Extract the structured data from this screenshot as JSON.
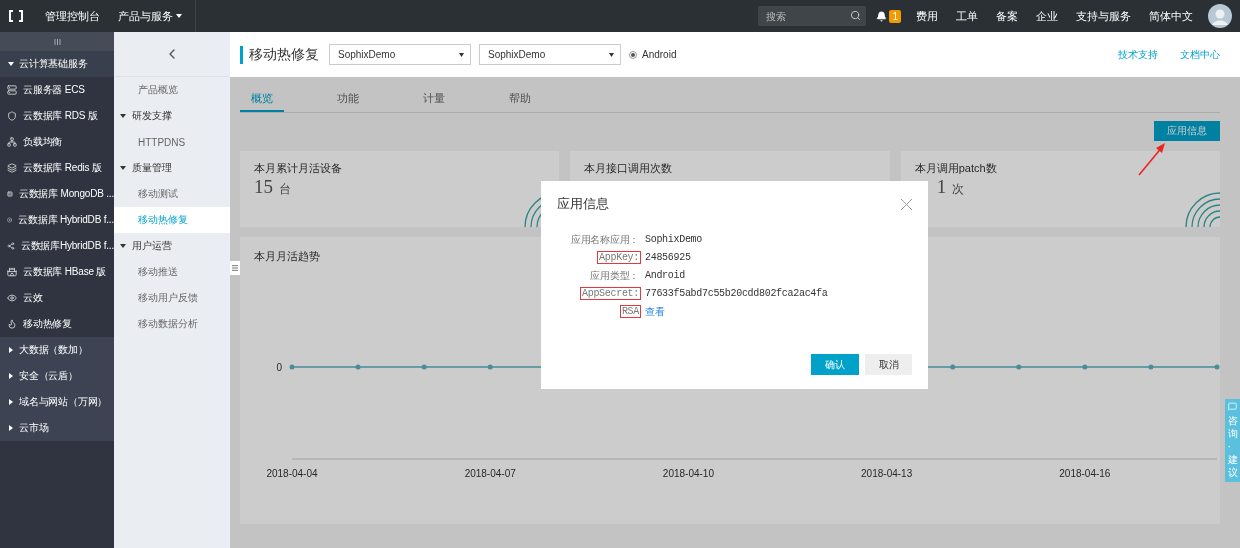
{
  "topbar": {
    "console": "管理控制台",
    "products": "产品与服务",
    "search": {
      "placeholder": "搜索"
    },
    "notification_count": "1",
    "links": [
      "费用",
      "工单",
      "备案",
      "企业",
      "支持与服务",
      "简体中文"
    ]
  },
  "sidebar": {
    "items": [
      {
        "kind": "group",
        "label": "云计算基础服务",
        "expanded": true
      },
      {
        "kind": "item",
        "label": "云服务器 ECS"
      },
      {
        "kind": "item",
        "label": "云数据库 RDS 版"
      },
      {
        "kind": "item",
        "label": "负载均衡"
      },
      {
        "kind": "item",
        "label": "云数据库 Redis 版"
      },
      {
        "kind": "item",
        "label": "云数据库 MongoDB ..."
      },
      {
        "kind": "item",
        "label": "云数据库 HybridDB f..."
      },
      {
        "kind": "item",
        "label": "云数据库HybridDB f..."
      },
      {
        "kind": "item",
        "label": "云数据库 HBase 版"
      },
      {
        "kind": "item",
        "label": "云效"
      },
      {
        "kind": "item",
        "label": "移动热修复"
      },
      {
        "kind": "group",
        "label": "大数据（数加）",
        "expanded": false
      },
      {
        "kind": "group",
        "label": "安全（云盾）",
        "expanded": false
      },
      {
        "kind": "group",
        "label": "域名与网站（万网）",
        "expanded": false
      },
      {
        "kind": "group",
        "label": "云市场",
        "expanded": false
      }
    ]
  },
  "subnav": {
    "items": [
      {
        "kind": "link",
        "label": "产品概览",
        "selected": false
      },
      {
        "kind": "group",
        "label": "研发支撑",
        "expanded": true
      },
      {
        "kind": "link",
        "label": "HTTPDNS",
        "selected": false
      },
      {
        "kind": "group",
        "label": "质量管理",
        "expanded": true
      },
      {
        "kind": "link",
        "label": "移动测试",
        "selected": false
      },
      {
        "kind": "link",
        "label": "移动热修复",
        "selected": true
      },
      {
        "kind": "group",
        "label": "用户运营",
        "expanded": true
      },
      {
        "kind": "link",
        "label": "移动推送",
        "selected": false
      },
      {
        "kind": "link",
        "label": "移动用户反馈",
        "selected": false
      },
      {
        "kind": "link",
        "label": "移动数据分析",
        "selected": false
      }
    ]
  },
  "header": {
    "title": "移动热修复",
    "selects": [
      "SophixDemo",
      "SophixDemo"
    ],
    "platform": {
      "label": "Android",
      "selected": true
    },
    "links": [
      "技术支持",
      "文档中心"
    ]
  },
  "tabs": [
    {
      "label": "概览",
      "selected": true
    },
    {
      "label": "功能",
      "selected": false
    },
    {
      "label": "计量",
      "selected": false
    },
    {
      "label": "帮助",
      "selected": false
    }
  ],
  "app_info_button": "应用信息",
  "stats": [
    {
      "kind": "full",
      "title": "本月累计月活设备",
      "value": "15",
      "unit": "台"
    },
    {
      "kind": "covered",
      "title": "本月接口调用次数"
    },
    {
      "kind": "partial",
      "title": "本月调用patch数",
      "value": "1",
      "unit": "次"
    }
  ],
  "trend": {
    "title": "本月月活趋势",
    "y_label": "0",
    "x_labels": [
      "2018-04-04",
      "2018-04-07",
      "2018-04-10",
      "2018-04-13",
      "2018-04-16"
    ]
  },
  "dialog": {
    "title": "应用信息",
    "rows": [
      {
        "label": "应用名称应用：",
        "value": "SophixDemo",
        "highlighted": false,
        "kind": "text"
      },
      {
        "label": "AppKey:",
        "value": "24856925",
        "highlighted": true,
        "kind": "text"
      },
      {
        "label": "应用类型：",
        "value": "Android",
        "highlighted": false,
        "kind": "text"
      },
      {
        "label": "AppSecret:",
        "value": "77633f5abd7c55b20cdd802fca2ac4fa",
        "highlighted": true,
        "kind": "text"
      },
      {
        "label": "RSA",
        "value": "查看",
        "highlighted": true,
        "kind": "link"
      }
    ],
    "confirm": "确认",
    "cancel": "取消"
  },
  "feedback_tab": "咨询·建议"
}
